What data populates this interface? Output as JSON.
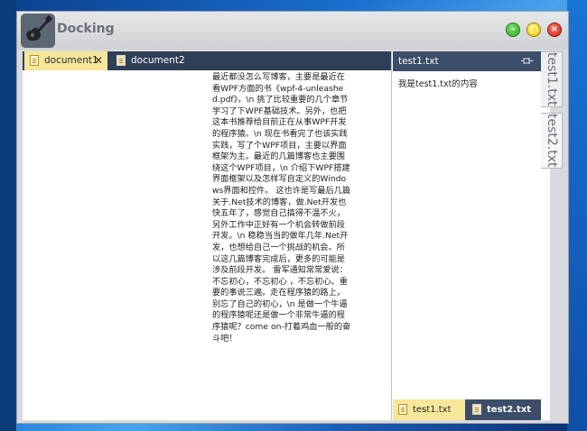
{
  "window": {
    "title": "Docking",
    "controls": {
      "minimize": "–",
      "maximize": "□",
      "close": "×"
    }
  },
  "documents": {
    "tabs": [
      {
        "label": "document1",
        "close": "✕"
      },
      {
        "label": "document2"
      }
    ],
    "body_text": "最近都没怎么写博客，主要是最近在看WPF方面的书《wpf-4-unleashed.pdf》，\\n 挑了比较重要的几个章节学习了下WPF基础技术。另外，也把这本书推荐给目前正在从事WPF开发的程序猿。\\n 现在书看完了也该实践实践，写了个WPF项目，主要以界面框架为主。最近的几篇博客也主要围绕这个WPF项目，\\n 介绍下WPF搭建界面框架以及怎样写自定义的Windows界面和控件。 这也许是写最后几篇关于.Net技术的博客，做.Net开发也快五年了，感觉自己搞得不温不火，另外工作中正好有一个机会转做前段开发。\\n 稳稳当当的做年几年.Net开发，也想给自己一个挑战的机会。所以这几篇博客完成后，更多的可能是涉及前段开发。 雷军通知常常爱说：不忘初心，不忘初心 ，不忘初心。重要的事说三遍。走在程序猿的路上，别忘了自己的初心，\\n 是做一个牛逼的程序猿呢还是做一个非常牛逼的程序猿呢？come on-打着鸡血一般的奋斗吧！"
  },
  "side_panel": {
    "title": "test1.txt",
    "content": "我是test1.txt的内容",
    "bottom_tabs": [
      {
        "label": "test1.txt"
      },
      {
        "label": "test2.txt"
      }
    ]
  },
  "vertical_tabs": [
    {
      "label": "test1.txt"
    },
    {
      "label": "test2.txt"
    }
  ],
  "colors": {
    "active_tab": "#f6e79a",
    "tab_strip": "#2f3f57",
    "panel_header": "#3b4d69"
  }
}
